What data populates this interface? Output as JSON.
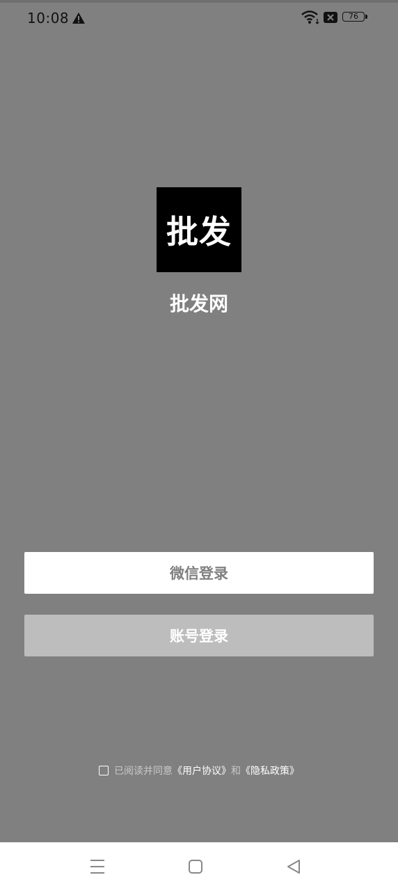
{
  "status_bar": {
    "time": "10:08",
    "battery": "76"
  },
  "app": {
    "logo_text": "批发",
    "name": "批发网"
  },
  "buttons": {
    "wechat_login": "微信登录",
    "account_login": "账号登录"
  },
  "agreement": {
    "prefix": "已阅读并同意",
    "user_agreement": "《用户协议》",
    "and": "和",
    "privacy_policy": "《隐私政策》"
  },
  "colors": {
    "overlay_bg": "#808080",
    "wechat_button_bg": "#ffffff",
    "account_button_bg": "#bdbdbd"
  },
  "nav_icons": [
    "menu-icon",
    "home-icon",
    "back-icon"
  ]
}
